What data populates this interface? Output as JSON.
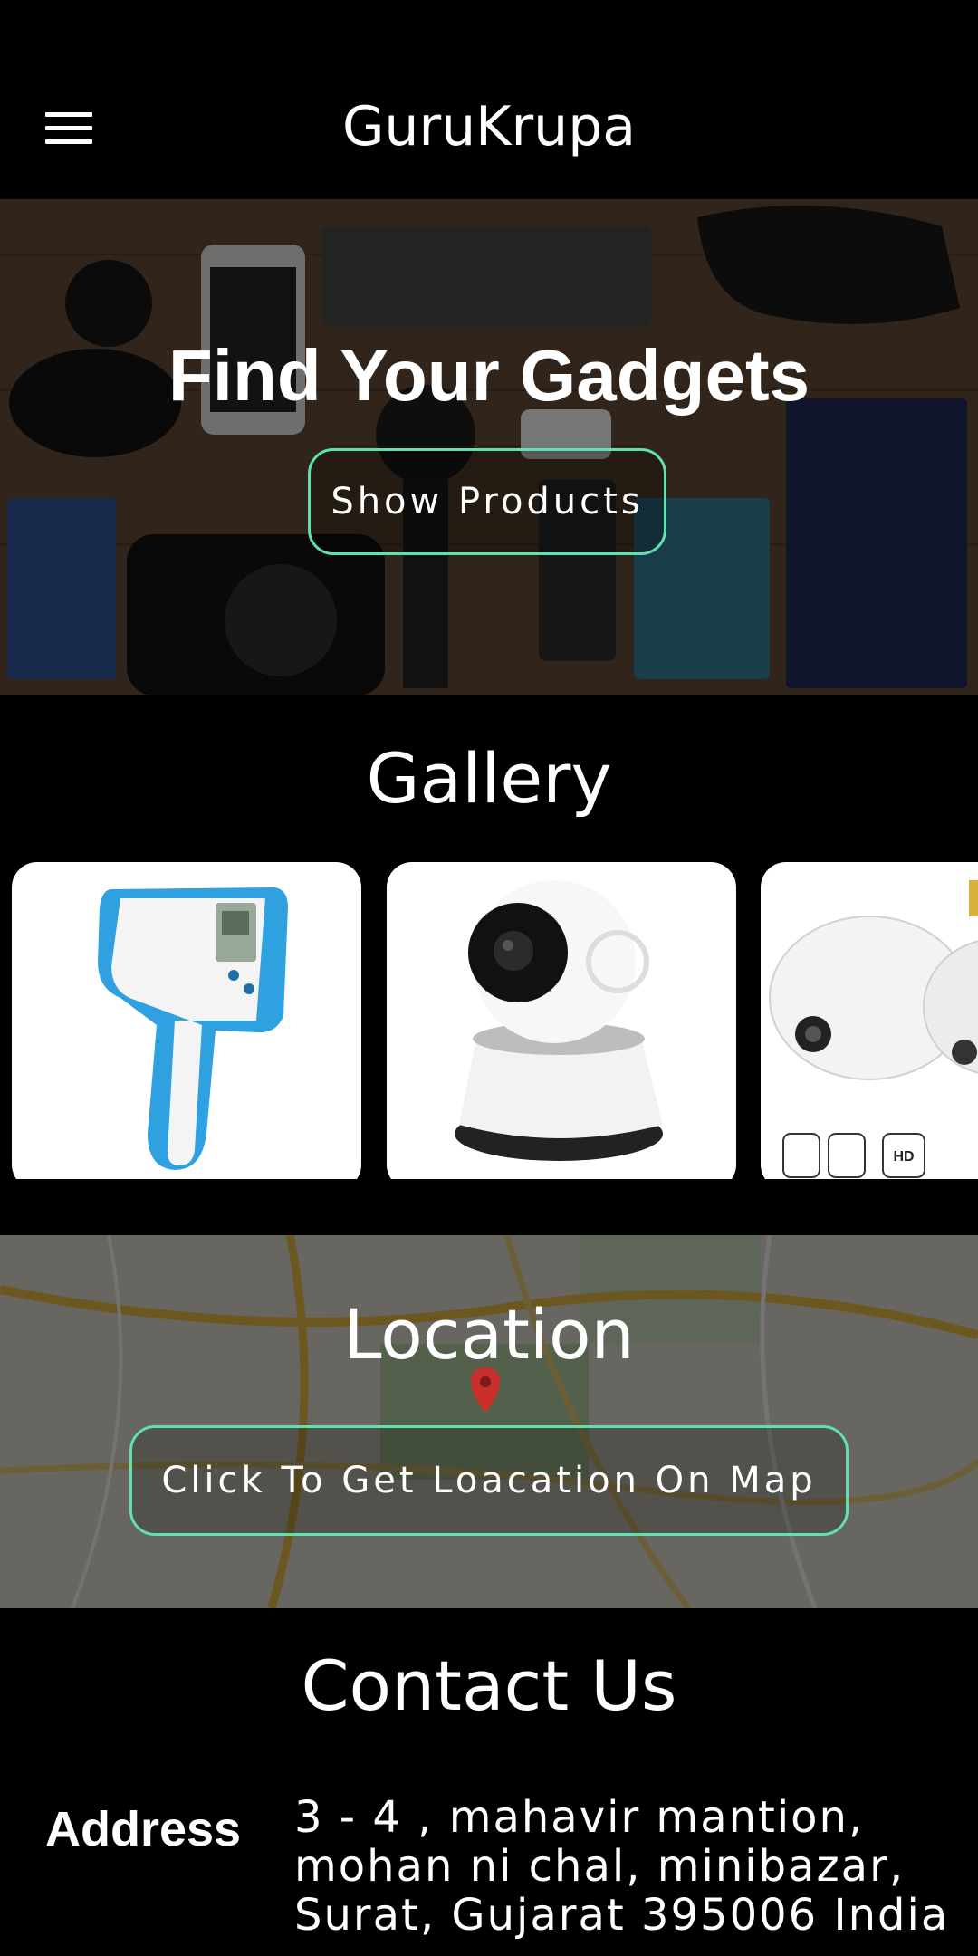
{
  "header": {
    "title": "GuruKrupa",
    "menu_icon": "hamburger-menu-icon"
  },
  "hero": {
    "title": "Find Your Gadgets",
    "button_label": "Show Products"
  },
  "gallery": {
    "title": "Gallery",
    "items": [
      {
        "icon": "infrared-thermometer-image"
      },
      {
        "icon": "security-camera-image"
      },
      {
        "icon": "bulb-camera-image",
        "feature_labels": [
          "HD"
        ]
      }
    ]
  },
  "location": {
    "title": "Location",
    "button_label": "Click To Get Loacation On Map",
    "pin_icon": "map-pin-icon"
  },
  "contact": {
    "title": "Contact Us",
    "address_label": "Address",
    "address_lines": [
      "3 - 4 , mahavir mantion,",
      "mohan ni chal, minibazar,",
      "Surat, Gujarat 395006 India"
    ]
  },
  "colors": {
    "accent": "#5fe0b0",
    "background": "#000000",
    "text": "#ffffff"
  }
}
